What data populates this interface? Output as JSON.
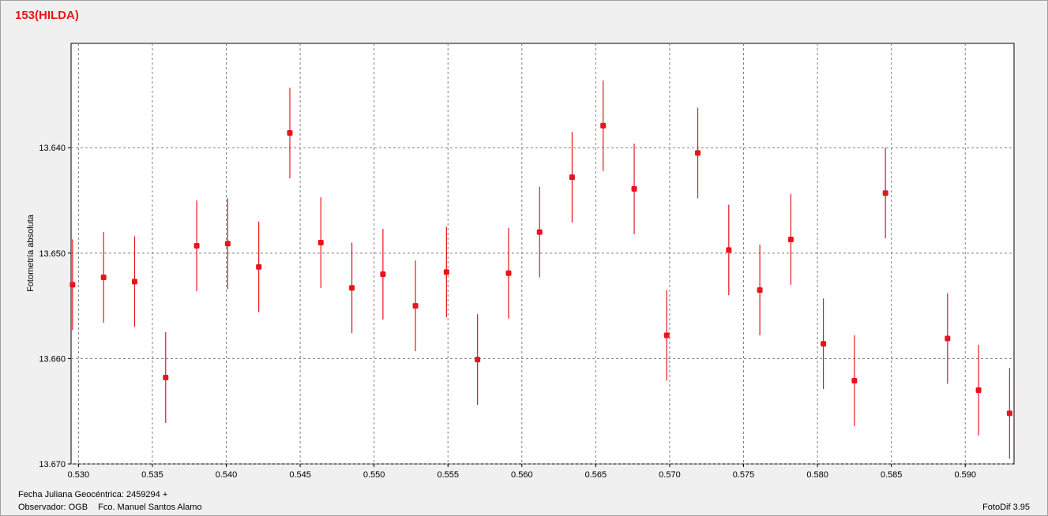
{
  "title": "153(HILDA)",
  "footer": {
    "date_label": "Fecha Juliana Geocéntrica: 2459294 +",
    "observer_code": "Observador: OGB",
    "observer_name": "Fco. Manuel Santos Alamo",
    "version": "FotoDif 3.95"
  },
  "colors": {
    "series": "#e8141c",
    "title": "#e8141c",
    "grid": "#808080"
  },
  "chart_data": {
    "type": "scatter",
    "title": "153(HILDA)",
    "xlabel": "",
    "ylabel": "Fotometría absoluta",
    "xlim": [
      0.5295,
      0.5933
    ],
    "ylim": [
      13.67,
      13.6301
    ],
    "y_inverted": true,
    "grid": true,
    "x_ticks": [
      0.53,
      0.535,
      0.54,
      0.545,
      0.55,
      0.555,
      0.56,
      0.565,
      0.57,
      0.575,
      0.58,
      0.585,
      0.59
    ],
    "x_tick_labels": [
      "0.530",
      "0.535",
      "0.540",
      "0.545",
      "0.550",
      "0.555",
      "0.560",
      "0.565",
      "0.570",
      "0.575",
      "0.580",
      "0.585",
      "0.590"
    ],
    "y_ticks": [
      13.64,
      13.65,
      13.66,
      13.67
    ],
    "y_tick_labels": [
      "13.640",
      "13.650",
      "13.660",
      "13.670"
    ],
    "points": [
      {
        "x": 0.5296,
        "y": 13.653,
        "err": 0.0043
      },
      {
        "x": 0.5317,
        "y": 13.6523,
        "err": 0.0043
      },
      {
        "x": 0.5338,
        "y": 13.6527,
        "err": 0.0043
      },
      {
        "x": 0.5359,
        "y": 13.6618,
        "err": 0.0043
      },
      {
        "x": 0.538,
        "y": 13.6493,
        "err": 0.0043
      },
      {
        "x": 0.5401,
        "y": 13.6491,
        "err": 0.0043
      },
      {
        "x": 0.5422,
        "y": 13.6513,
        "err": 0.0043
      },
      {
        "x": 0.5443,
        "y": 13.6386,
        "err": 0.0043
      },
      {
        "x": 0.5464,
        "y": 13.649,
        "err": 0.0043
      },
      {
        "x": 0.5485,
        "y": 13.6533,
        "err": 0.0043
      },
      {
        "x": 0.5506,
        "y": 13.652,
        "err": 0.0043
      },
      {
        "x": 0.5528,
        "y": 13.655,
        "err": 0.0043
      },
      {
        "x": 0.5549,
        "y": 13.6518,
        "err": 0.0043
      },
      {
        "x": 0.557,
        "y": 13.6601,
        "err": 0.0043
      },
      {
        "x": 0.5591,
        "y": 13.6519,
        "err": 0.0043
      },
      {
        "x": 0.5612,
        "y": 13.648,
        "err": 0.0043
      },
      {
        "x": 0.5634,
        "y": 13.6428,
        "err": 0.0043
      },
      {
        "x": 0.5655,
        "y": 13.6379,
        "err": 0.0043
      },
      {
        "x": 0.5676,
        "y": 13.6439,
        "err": 0.0043
      },
      {
        "x": 0.5698,
        "y": 13.6578,
        "err": 0.0043
      },
      {
        "x": 0.5719,
        "y": 13.6405,
        "err": 0.0043
      },
      {
        "x": 0.574,
        "y": 13.6497,
        "err": 0.0043
      },
      {
        "x": 0.5761,
        "y": 13.6535,
        "err": 0.0043
      },
      {
        "x": 0.5782,
        "y": 13.6487,
        "err": 0.0043
      },
      {
        "x": 0.5804,
        "y": 13.6586,
        "err": 0.0043
      },
      {
        "x": 0.5825,
        "y": 13.6621,
        "err": 0.0043
      },
      {
        "x": 0.5846,
        "y": 13.6443,
        "err": 0.0043
      },
      {
        "x": 0.5888,
        "y": 13.6581,
        "err": 0.0043
      },
      {
        "x": 0.5909,
        "y": 13.663,
        "err": 0.0043
      },
      {
        "x": 0.593,
        "y": 13.6652,
        "err": 0.0043
      }
    ]
  }
}
